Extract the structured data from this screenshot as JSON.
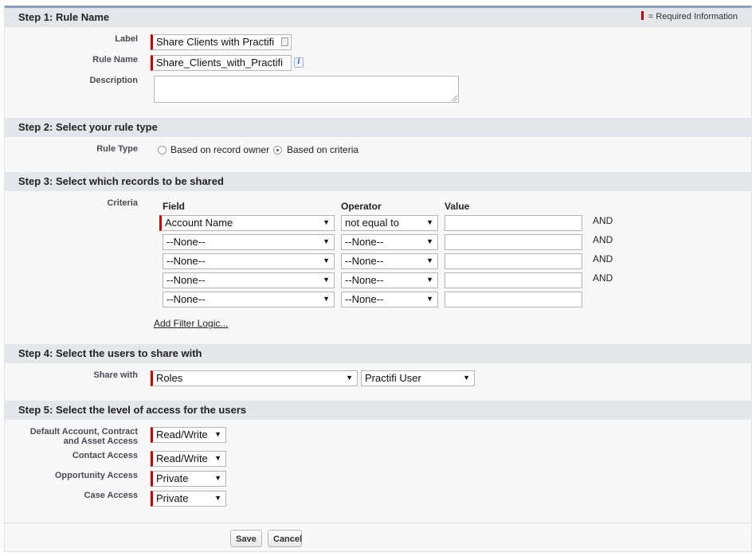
{
  "required_legend": "= Required Information",
  "step1": {
    "title": "Step 1: Rule Name",
    "label_label": "Label",
    "label_value": "Share Clients with Practifi",
    "rule_name_label": "Rule Name",
    "rule_name_value": "Share_Clients_with_Practifi",
    "description_label": "Description",
    "description_value": "",
    "info_icon_text": "i"
  },
  "step2": {
    "title": "Step 2: Select your rule type",
    "rule_type_label": "Rule Type",
    "options": [
      "Based on record owner",
      "Based on criteria"
    ],
    "selected": "Based on criteria"
  },
  "step3": {
    "title": "Step 3: Select which records to be shared",
    "criteria_label": "Criteria",
    "headers": {
      "field": "Field",
      "operator": "Operator",
      "value": "Value"
    },
    "rows": [
      {
        "field": "Account Name",
        "operator": "not equal to",
        "value": "",
        "conj": "AND"
      },
      {
        "field": "--None--",
        "operator": "--None--",
        "value": "",
        "conj": "AND"
      },
      {
        "field": "--None--",
        "operator": "--None--",
        "value": "",
        "conj": "AND"
      },
      {
        "field": "--None--",
        "operator": "--None--",
        "value": "",
        "conj": "AND"
      },
      {
        "field": "--None--",
        "operator": "--None--",
        "value": "",
        "conj": ""
      }
    ],
    "add_filter_logic": "Add Filter Logic..."
  },
  "step4": {
    "title": "Step 4: Select the users to share with",
    "share_with_label": "Share with",
    "share_type": "Roles",
    "share_target": "Practifi User"
  },
  "step5": {
    "title": "Step 5: Select the level of access for the users",
    "default_access_label_line1": "Default Account, Contract",
    "default_access_label_line2": "and Asset Access",
    "default_access": "Read/Write",
    "contact_access_label": "Contact Access",
    "contact_access": "Read/Write",
    "opportunity_access_label": "Opportunity Access",
    "opportunity_access": "Private",
    "case_access_label": "Case Access",
    "case_access": "Private"
  },
  "buttons": {
    "save": "Save",
    "cancel": "Cancel"
  },
  "colors": {
    "required": "#cc0000",
    "section_bg": "#e3e6eb",
    "panel_top_border": "#8a9ebe"
  }
}
